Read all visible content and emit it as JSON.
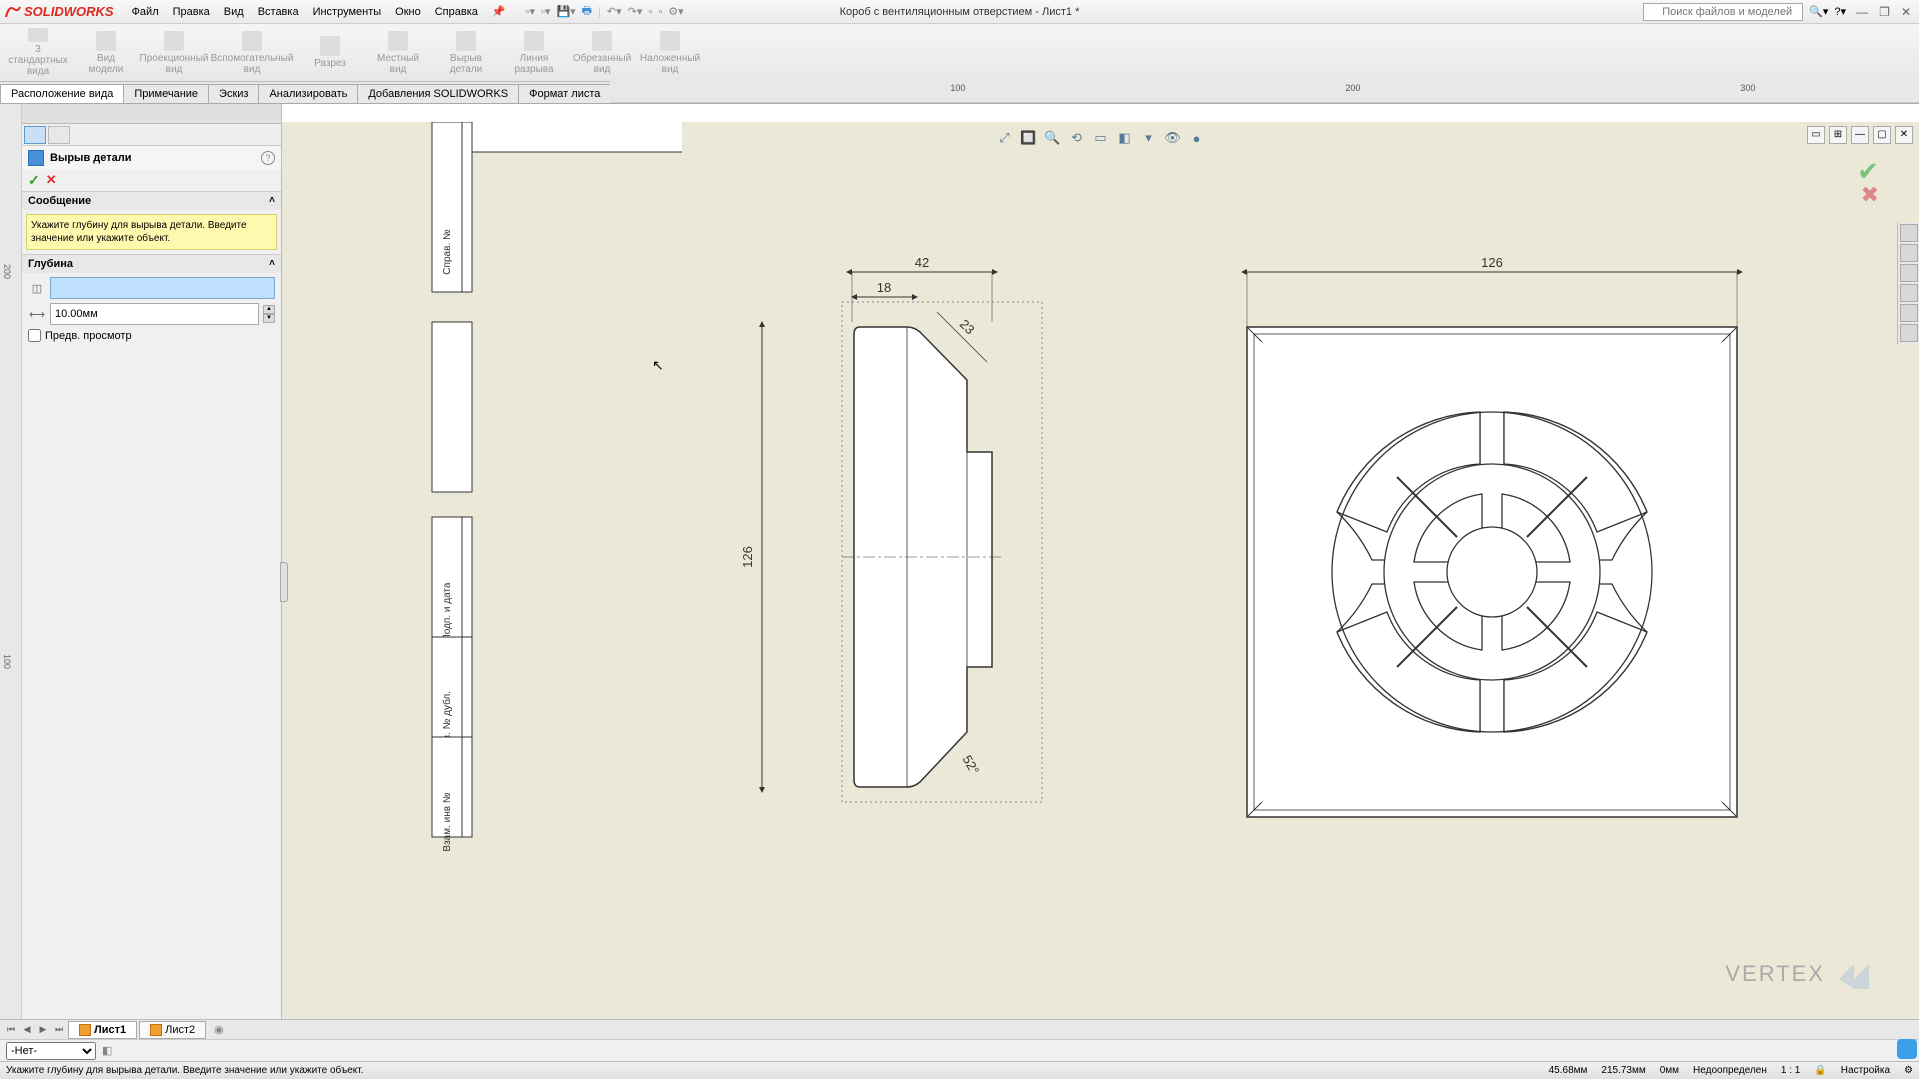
{
  "app": {
    "name": "SOLIDWORKS"
  },
  "doc_title": "Короб с вентиляционным отверстием - Лист1 *",
  "menu": [
    "Файл",
    "Правка",
    "Вид",
    "Вставка",
    "Инструменты",
    "Окно",
    "Справка"
  ],
  "search": {
    "placeholder": "Поиск файлов и моделей"
  },
  "ribbon": [
    {
      "label": "3\nстандартных\nвида"
    },
    {
      "label": "Вид\nмодели"
    },
    {
      "label": "Проекционный\nвид"
    },
    {
      "label": "Вспомогательный\nвид"
    },
    {
      "label": "Разрез"
    },
    {
      "label": "Местный\nвид"
    },
    {
      "label": "Вырыв\nдетали"
    },
    {
      "label": "Линия\nразрыва"
    },
    {
      "label": "Обрезанный\nвид"
    },
    {
      "label": "Наложенный\nвид"
    }
  ],
  "tabs": [
    "Расположение вида",
    "Примечание",
    "Эскиз",
    "Анализировать",
    "Добавления SOLIDWORKS",
    "Формат листа"
  ],
  "active_tab": 0,
  "feature": {
    "title": "Вырыв детали",
    "section_msg_title": "Сообщение",
    "msg": "Укажите глубину для вырыва детали. Введите значение или укажите объект.",
    "section_depth_title": "Глубина",
    "depth_value": "10.00мм",
    "preview_label": "Предв. просмотр"
  },
  "ruler_h": [
    {
      "pos": 520,
      "label": "100"
    },
    {
      "pos": 912,
      "label": "200"
    },
    {
      "pos": 1305,
      "label": "300"
    }
  ],
  "ruler_v": [
    {
      "pos": 175,
      "label": "200"
    },
    {
      "pos": 560,
      "label": "100"
    }
  ],
  "drawing": {
    "dims_side": {
      "w42": "42",
      "w18": "18",
      "h126": "126",
      "r23": "23",
      "a52": "52°"
    },
    "dims_front": {
      "w126": "126"
    },
    "title_cells": [
      "Справ. №",
      "",
      "Подп. и дата",
      "Инв. № дубл.",
      "Взам. инв №"
    ]
  },
  "sheet_tabs": [
    {
      "label": "Лист1",
      "active": true
    },
    {
      "label": "Лист2",
      "active": false
    }
  ],
  "layer": {
    "value": "-Нет-"
  },
  "status": {
    "msg": "Укажите глубину для вырыва детали. Введите значение или укажите объект.",
    "coord1": "45.68мм",
    "coord2": "215.73мм",
    "coord3": "0мм",
    "state": "Недоопределен",
    "scale": "1 : 1",
    "custom": "Настройка"
  },
  "watermark": "VERTEX"
}
